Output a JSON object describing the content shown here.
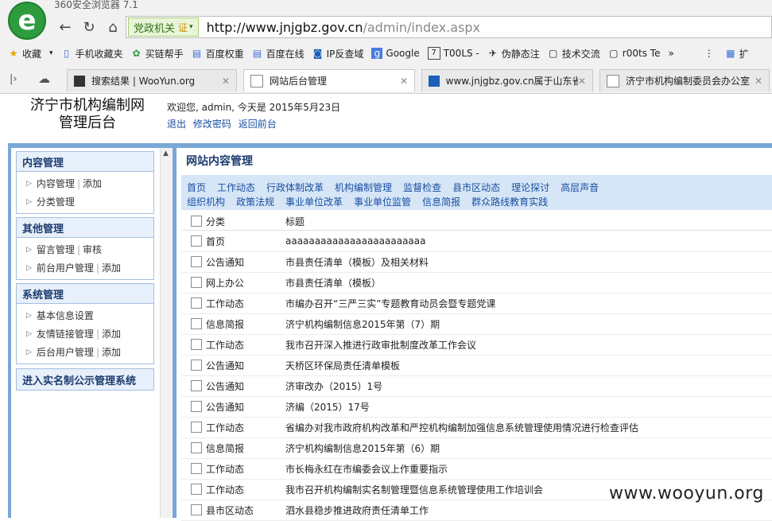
{
  "app": {
    "title": "360安全浏览器 7.1"
  },
  "address_bar": {
    "badge": "党政机关",
    "cert": "证",
    "url_main": "http://www.jnjgbz.gov.cn",
    "url_path": "/admin/index.aspx"
  },
  "bookmarks": [
    {
      "label": "收藏",
      "icon": "star-icon"
    },
    {
      "label": "手机收藏夹",
      "icon": "phone-icon"
    },
    {
      "label": "买链帮手",
      "icon": "app-icon"
    },
    {
      "label": "百度权重",
      "icon": "page-icon"
    },
    {
      "label": "百度在线",
      "icon": "page-icon"
    },
    {
      "label": "IP反查域",
      "icon": "page-icon"
    },
    {
      "label": "Google",
      "icon": "google-icon"
    },
    {
      "label": "T00LS -",
      "icon": "page-icon"
    },
    {
      "label": "伪静态注",
      "icon": "page-icon"
    },
    {
      "label": "技术交流",
      "icon": "page-icon"
    },
    {
      "label": "r00ts Te",
      "icon": "page-icon"
    },
    {
      "label": "扩",
      "icon": "grid-icon"
    }
  ],
  "tabs": [
    {
      "label": "搜索结果 | WooYun.org"
    },
    {
      "label": "网站后台管理"
    },
    {
      "label": "www.jnjgbz.gov.cn属于山东省"
    },
    {
      "label": "济宁市机构编制委员会办公室"
    }
  ],
  "header": {
    "site_title_line1": "济宁市机构编制网",
    "site_title_line2": "管理后台",
    "welcome": "欢迎您, admin, 今天是 2015年5月23日",
    "links": [
      "退出",
      "修改密码",
      "返回前台"
    ]
  },
  "sidebar": {
    "content_mgmt": {
      "title": "内容管理",
      "item1": "内容管理",
      "item1_add": "添加",
      "item2": "分类管理"
    },
    "other_mgmt": {
      "title": "其他管理",
      "item1": "留言管理",
      "item1_add": "审核",
      "item2": "前台用户管理",
      "item2_add": "添加"
    },
    "system_mgmt": {
      "title": "系统管理",
      "item1": "基本信息设置",
      "item2": "友情链接管理",
      "item2_add": "添加",
      "item3": "后台用户管理",
      "item3_add": "添加"
    },
    "realname": {
      "title": "进入实名制公示管理系统"
    }
  },
  "content": {
    "title": "网站内容管理",
    "categories_row1": [
      "首页",
      "工作动态",
      "行政体制改革",
      "机构编制管理",
      "监督检查",
      "县市区动态",
      "理论探讨",
      "高层声音"
    ],
    "categories_row2": [
      "组织机构",
      "政策法规",
      "事业单位改革",
      "事业单位监管",
      "信息简报",
      "群众路线教育实践"
    ],
    "table_headers": {
      "category": "分类",
      "title": "标题"
    },
    "rows": [
      {
        "cat": "首页",
        "title": "aaaaaaaaaaaaaaaaaaaaaaaa"
      },
      {
        "cat": "公告通知",
        "title": "市县责任清单（模板）及相关材料"
      },
      {
        "cat": "网上办公",
        "title": "市县责任清单（模板）"
      },
      {
        "cat": "工作动态",
        "title": "市编办召开“三严三实”专题教育动员会暨专题党课"
      },
      {
        "cat": "信息简报",
        "title": "济宁机构编制信息2015年第（7）期"
      },
      {
        "cat": "工作动态",
        "title": "我市召开深入推进行政审批制度改革工作会议"
      },
      {
        "cat": "公告通知",
        "title": "天桥区环保局责任清单模板"
      },
      {
        "cat": "公告通知",
        "title": "济审改办（2015）1号"
      },
      {
        "cat": "公告通知",
        "title": "济编（2015）17号"
      },
      {
        "cat": "工作动态",
        "title": "省编办对我市政府机构改革和严控机构编制加强信息系统管理使用情况进行检查评估"
      },
      {
        "cat": "信息简报",
        "title": "济宁机构编制信息2015年第（6）期"
      },
      {
        "cat": "工作动态",
        "title": "市长梅永红在市编委会议上作重要指示"
      },
      {
        "cat": "工作动态",
        "title": "我市召开机构编制实名制管理暨信息系统管理使用工作培训会"
      },
      {
        "cat": "县市区动态",
        "title": "泗水县稳步推进政府责任清单工作"
      }
    ]
  },
  "watermark": "www.wooyun.org"
}
